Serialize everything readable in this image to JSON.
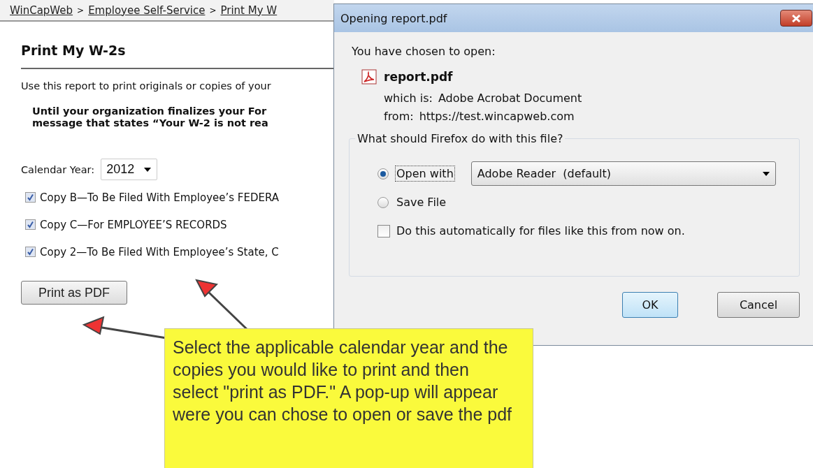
{
  "breadcrumb": [
    {
      "kind": "link",
      "text": "WinCapWeb"
    },
    {
      "kind": "separator",
      "text": ">"
    },
    {
      "kind": "link",
      "text": "Employee Self-Service"
    },
    {
      "kind": "separator",
      "text": ">"
    },
    {
      "kind": "link",
      "text": "Print My W"
    }
  ],
  "page": {
    "title": "Print My W-2s",
    "intro": "Use this report to print originals or copies of your",
    "notice": [
      "Until your organization finalizes your For",
      "message that states “Your W-2 is not rea"
    ],
    "year_label": "Calendar Year:",
    "year": "2012",
    "copies": [
      {
        "label": "Copy B—To Be Filed With Employee’s FEDERA",
        "checked": true
      },
      {
        "label": "Copy C—For EMPLOYEE’S RECORDS",
        "checked": true
      },
      {
        "label": "Copy 2—To Be Filed With Employee’s State, C",
        "checked": true
      }
    ],
    "button": "Print as PDF"
  },
  "dialog": {
    "title": "Opening report.pdf",
    "intro": "You have chosen to open:",
    "file": "report.pdf",
    "details": [
      {
        "label": "which is:",
        "value": "Adobe Acrobat Document"
      },
      {
        "label": "from:",
        "value": "https://test.wincapweb.com"
      }
    ],
    "group_title": "What should Firefox do with this file?",
    "options": [
      {
        "label": "Open with",
        "selected": true
      },
      {
        "label": "Save File",
        "selected": false
      }
    ],
    "app": "Adobe Reader  (default)",
    "auto": {
      "label": "Do this automatically for files like this from now on.",
      "checked": false
    },
    "buttons": [
      {
        "label": "OK",
        "default": true
      },
      {
        "label": "Cancel",
        "default": false
      }
    ]
  },
  "callout": {
    "text": "Select the applicable calendar year and the copies you would like to print and then select \"print as PDF.\" A pop-up will appear were you can chose to open or save the pdf"
  }
}
